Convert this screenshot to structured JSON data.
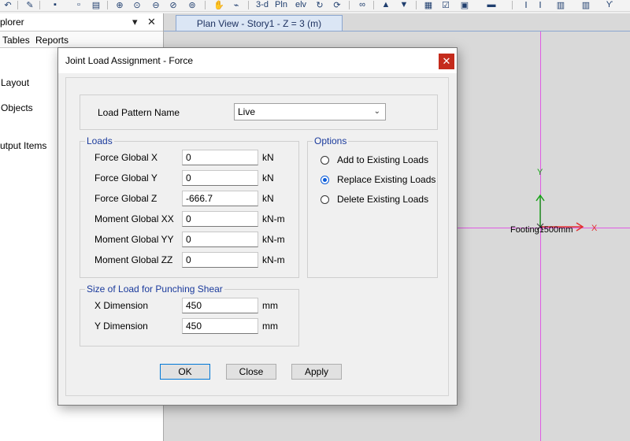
{
  "toolbar": {
    "icons": [
      "undo-icon",
      "pencil-icon",
      "save-icon",
      "print-icon",
      "zoom-in-icon",
      "zoom-window-icon",
      "zoom-out-icon",
      "zoom-previous-icon",
      "zoom-restore-icon",
      "pan-icon",
      "rubber-band-icon",
      "3d-view-icon",
      "plan-view-icon",
      "elevation-view-icon",
      "rotate-icon",
      "refresh-icon",
      "glasses-icon",
      "move-up-icon",
      "move-down-icon",
      "select-icon",
      "check-icon",
      "assign-icon",
      "display-icon",
      "text-icon",
      "beam-icon",
      "wall-icon",
      "column-icon"
    ],
    "view_3d_text": "3-d",
    "view_plan_text": "Pln",
    "view_elev_text": "elv"
  },
  "explorer": {
    "title": "plorer",
    "tabs": [
      "Tables",
      "Reports"
    ],
    "items": [
      "Layout",
      "Objects",
      "utput Items"
    ],
    "dropdown_glyph": "▾",
    "close_glyph": "✕"
  },
  "canvas": {
    "tab_label": "Plan View - Story1 - Z = 3 (m)",
    "footing_label": "Footing1500mm",
    "axis_x": "X",
    "axis_y": "Y"
  },
  "dialog": {
    "title": "Joint Load Assignment - Force",
    "close_glyph": "✕",
    "load_pattern": {
      "label": "Load Pattern Name",
      "value": "Live"
    },
    "loads": {
      "legend": "Loads",
      "rows": [
        {
          "label": "Force Global X",
          "value": "0",
          "unit": "kN"
        },
        {
          "label": "Force Global Y",
          "value": "0",
          "unit": "kN"
        },
        {
          "label": "Force Global Z",
          "value": "-666.7",
          "unit": "kN"
        },
        {
          "label": "Moment Global XX",
          "value": "0",
          "unit": "kN-m"
        },
        {
          "label": "Moment Global YY",
          "value": "0",
          "unit": "kN-m"
        },
        {
          "label": "Moment Global ZZ",
          "value": "0",
          "unit": "kN-m"
        }
      ]
    },
    "options": {
      "legend": "Options",
      "items": [
        {
          "label": "Add to Existing Loads",
          "checked": false
        },
        {
          "label": "Replace Existing Loads",
          "checked": true
        },
        {
          "label": "Delete Existing Loads",
          "checked": false
        }
      ]
    },
    "punching": {
      "legend": "Size of Load for Punching Shear",
      "rows": [
        {
          "label": "X Dimension",
          "value": "450",
          "unit": "mm"
        },
        {
          "label": "Y Dimension",
          "value": "450",
          "unit": "mm"
        }
      ]
    },
    "buttons": {
      "ok": "OK",
      "close": "Close",
      "apply": "Apply"
    }
  },
  "colors": {
    "close_red": "#c42b1c",
    "legend_blue": "#1a3a9c",
    "gridline_magenta": "#e05be3",
    "radio_blue": "#0a5bd8"
  }
}
